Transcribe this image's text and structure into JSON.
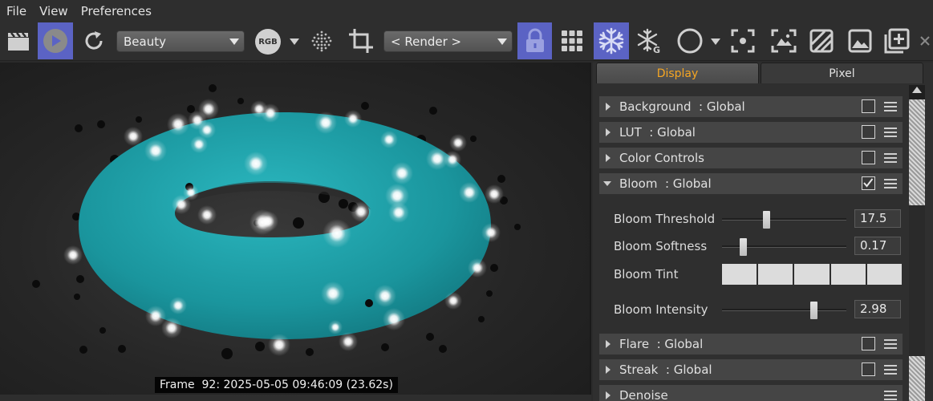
{
  "menu": [
    "File",
    "View",
    "Preferences"
  ],
  "toolbar": {
    "pass_dropdown": "Beauty",
    "rgb_label": "RGB",
    "render_dropdown": "< Render >",
    "colors": {
      "active": "#5b63c4",
      "icon": "#d0d0d0"
    }
  },
  "viewport": {
    "frame_label": "Frame  92: 2025-05-05 09:46:09 (23.62s)",
    "colors": {
      "torus": "#1c9aa3",
      "glow": "#ffffff"
    }
  },
  "panel": {
    "tabs": {
      "display": "Display",
      "pixel": "Pixel"
    },
    "colors": {
      "active_tab_text": "#f5a623"
    },
    "sections": [
      {
        "label": "Background  : Global",
        "expanded": false,
        "checked": false
      },
      {
        "label": "LUT  : Global",
        "expanded": false,
        "checked": false
      },
      {
        "label": "Color Controls",
        "expanded": false,
        "checked": false
      },
      {
        "label": "Bloom  : Global",
        "expanded": true,
        "checked": true
      },
      {
        "label": "Flare  : Global",
        "expanded": false,
        "checked": false
      },
      {
        "label": "Streak  : Global",
        "expanded": false,
        "checked": false
      },
      {
        "label": "Denoise",
        "expanded": false,
        "checked": false
      }
    ],
    "bloom": {
      "threshold_label": "Bloom Threshold",
      "threshold_value": "17.5",
      "threshold_slider_fraction": 0.36,
      "softness_label": "Bloom Softness",
      "softness_value": "0.17",
      "softness_slider_fraction": 0.17,
      "tint_label": "Bloom Tint",
      "intensity_label": "Bloom Intensity",
      "intensity_value": "2.98",
      "intensity_slider_fraction": 0.74
    }
  }
}
